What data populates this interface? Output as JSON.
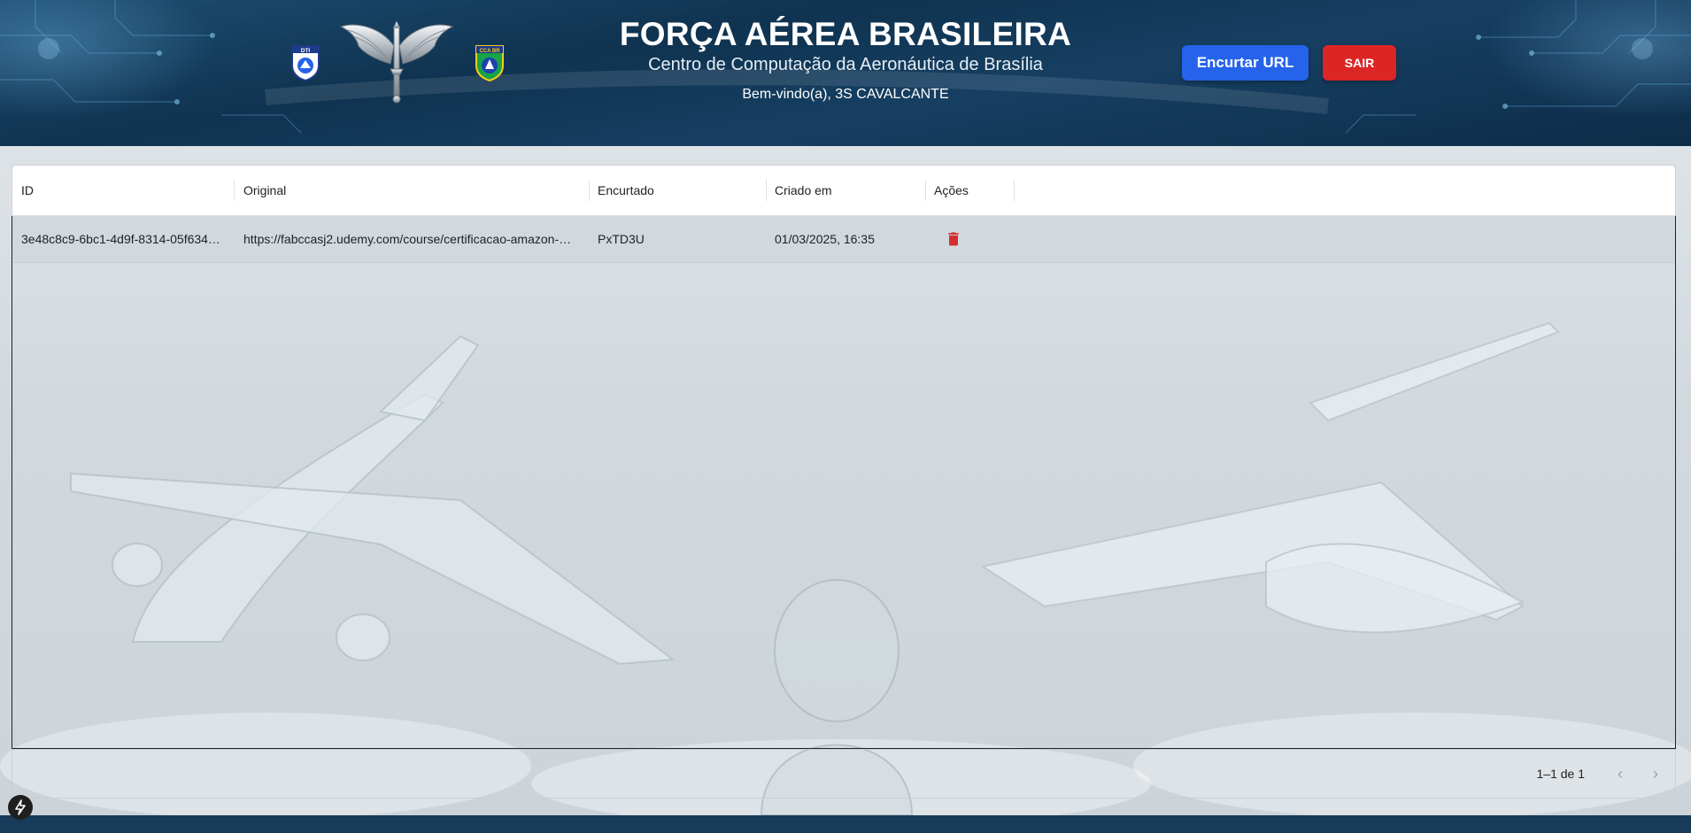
{
  "header": {
    "title": "FORÇA AÉREA BRASILEIRA",
    "subtitle": "Centro de Computação da Aeronáutica de Brasília",
    "welcome": "Bem-vindo(a), 3S CAVALCANTE",
    "logos": {
      "left": "dti-logo",
      "center": "fab-wings-emblem",
      "right": "cca-br-logo",
      "left_text": "DTI",
      "right_text": "CCA BR"
    },
    "shorten_button": "Encurtar URL",
    "logout_button": "SAIR"
  },
  "table": {
    "columns": [
      "ID",
      "Original",
      "Encurtado",
      "Criado em",
      "Ações"
    ],
    "rows": [
      {
        "id": "3e48c8c9-6bc1-4d9f-8314-05f634…",
        "original": "https://fabccasj2.udemy.com/course/certificacao-amazon-…",
        "encurtado": "PxTD3U",
        "criado_em": "01/03/2025, 16:35",
        "action_icon": "trash-icon"
      }
    ],
    "pagination": {
      "label": "1–1 de 1",
      "prev_icon": "chevron-left-icon",
      "next_icon": "chevron-right-icon"
    }
  },
  "colors": {
    "header_bg": "#0f3350",
    "primary_button": "#2563eb",
    "danger_button": "#dc2626",
    "trash_icon": "#d32f2f"
  },
  "help_icon": "lightning-icon"
}
